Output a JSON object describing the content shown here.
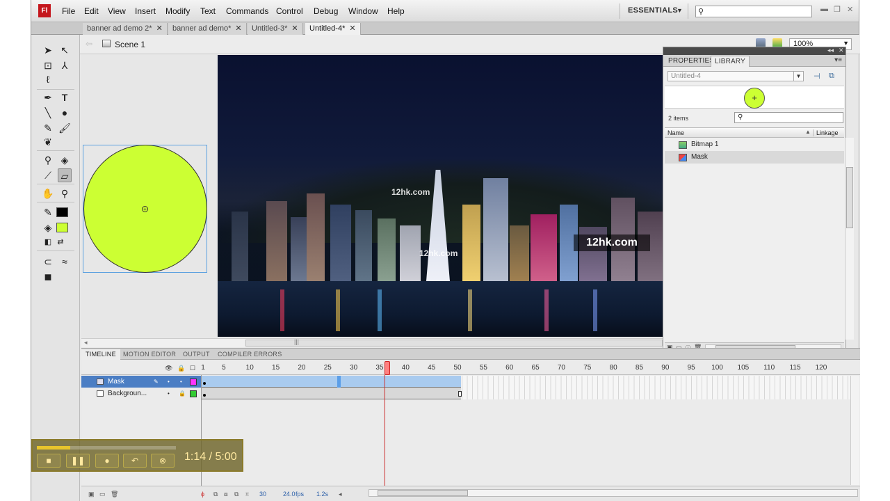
{
  "menu": {
    "logo": "Fl",
    "items": [
      "File",
      "Edit",
      "View",
      "Insert",
      "Modify",
      "Text",
      "Commands",
      "Control",
      "Debug",
      "Window",
      "Help"
    ],
    "workspace": "ESSENTIALS"
  },
  "doc_tabs": [
    {
      "label": "banner ad demo 2*",
      "active": false
    },
    {
      "label": "banner ad demo*",
      "active": false
    },
    {
      "label": "Untitled-3*",
      "active": false
    },
    {
      "label": "Untitled-4*",
      "active": true
    }
  ],
  "editbar": {
    "scene": "Scene 1",
    "zoom": "100%"
  },
  "stage": {
    "watermark_small_1": "12hk.com",
    "watermark_small_2": "12hk.com",
    "watermark_big": "12hk.com",
    "circle_color": "#ccff33"
  },
  "toolbox": {
    "stroke_color": "#000000",
    "fill_color": "#ccff33"
  },
  "library": {
    "tabs": [
      "PROPERTIES",
      "LIBRARY"
    ],
    "active_tab": "LIBRARY",
    "document": "Untitled-4",
    "item_count": "2 items",
    "columns": {
      "name": "Name",
      "linkage": "Linkage"
    },
    "items": [
      {
        "name": "Bitmap 1",
        "icon": "bitmap-icon"
      },
      {
        "name": "Mask",
        "icon": "graphic-symbol-icon"
      }
    ]
  },
  "timeline": {
    "tabs": [
      "TIMELINE",
      "MOTION EDITOR",
      "OUTPUT",
      "COMPILER ERRORS"
    ],
    "frame_numbers": [
      "1",
      "5",
      "10",
      "15",
      "20",
      "25",
      "30",
      "35",
      "40",
      "45",
      "50",
      "55",
      "60",
      "65",
      "70",
      "75",
      "80",
      "85",
      "90",
      "95",
      "100",
      "105",
      "110",
      "115",
      "120"
    ],
    "layers": [
      {
        "name": "Mask",
        "color": "#ff33ff"
      },
      {
        "name": "Backgroun...",
        "color": "#33cc33"
      }
    ],
    "current_frame": "30",
    "fps": "24.0",
    "fps_unit": "fps",
    "elapsed": "1.2s"
  },
  "player": {
    "time": "1:14 / 5:00",
    "progress": 0.24
  }
}
